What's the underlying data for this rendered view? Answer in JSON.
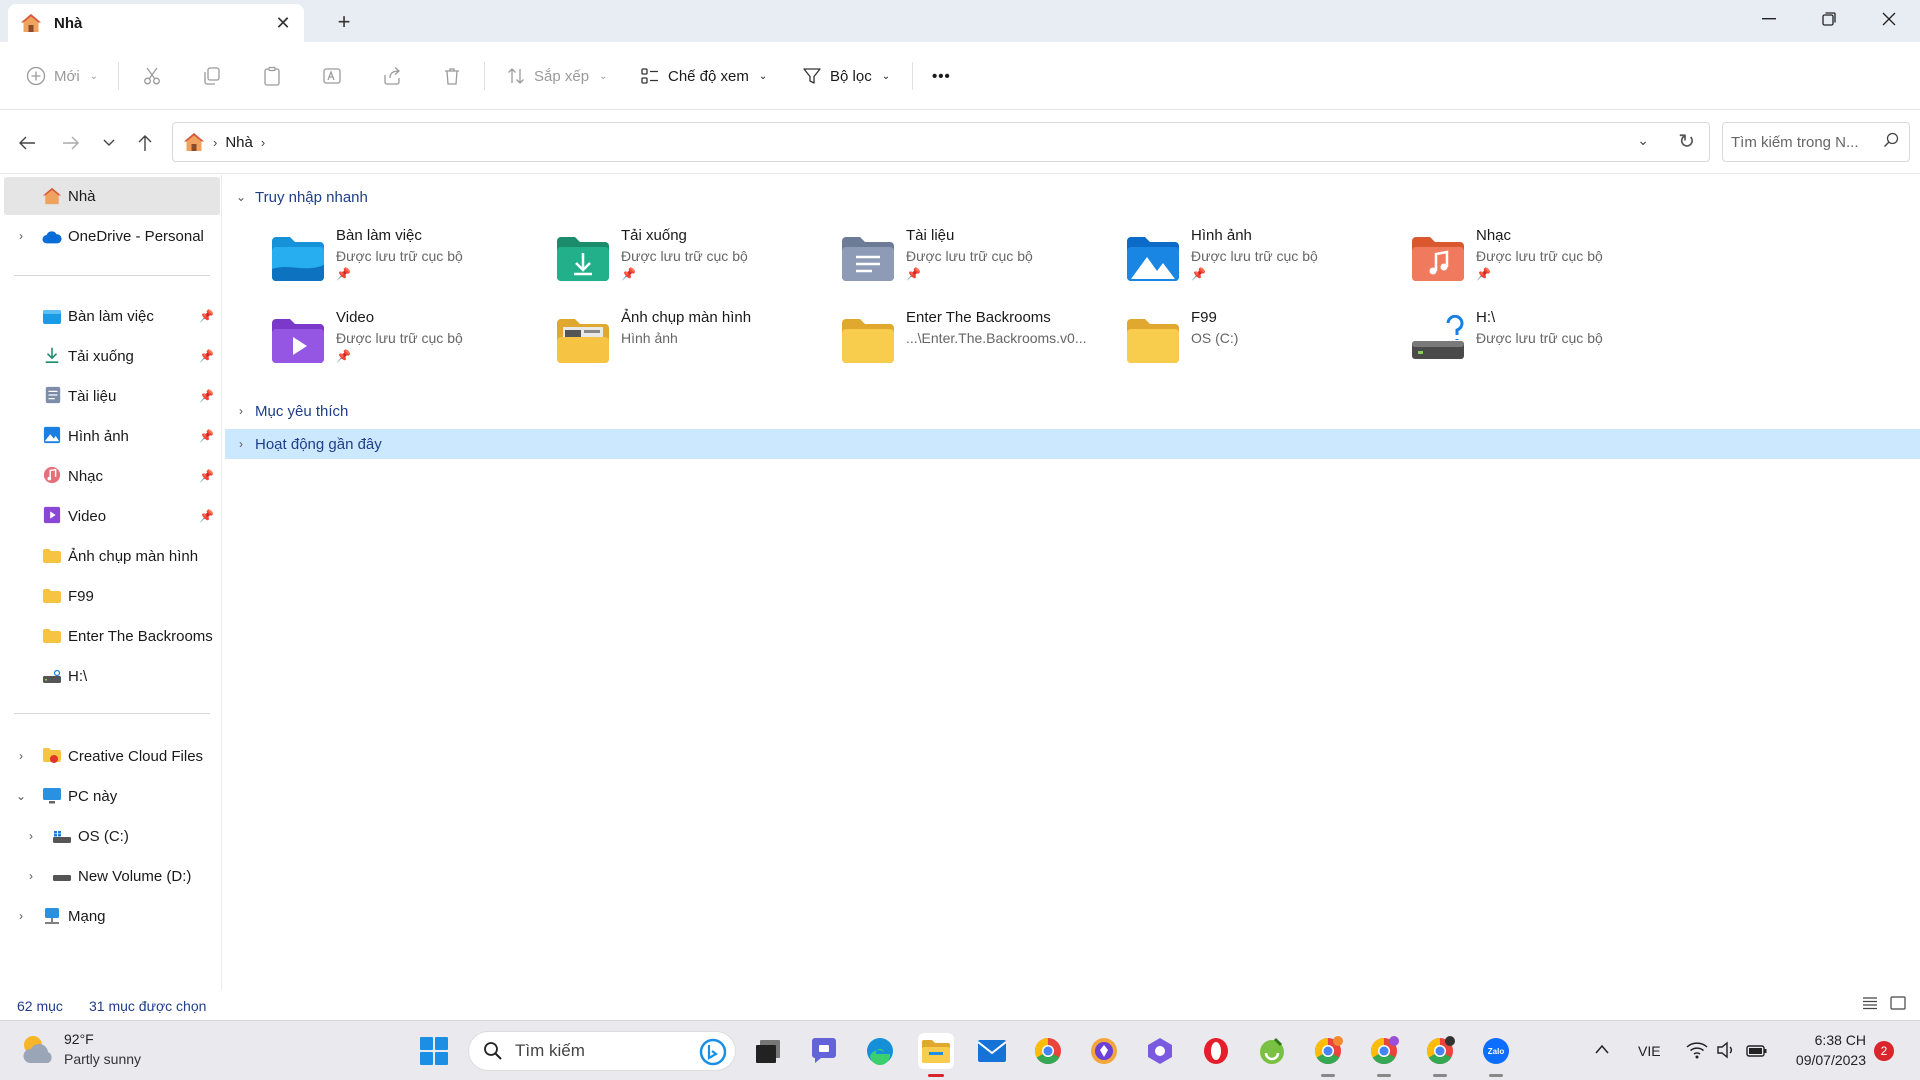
{
  "window": {
    "tab_title": "Nhà"
  },
  "toolbar": {
    "new": "Mới",
    "sort": "Sắp xếp",
    "view": "Chế độ xem",
    "filter": "Bộ lọc",
    "more": "•••"
  },
  "address": {
    "location": "Nhà",
    "search_placeholder": "Tìm kiếm trong N..."
  },
  "sidebar": {
    "home": "Nhà",
    "onedrive": "OneDrive - Personal",
    "pinned": [
      {
        "label": "Bàn làm việc"
      },
      {
        "label": "Tải xuống"
      },
      {
        "label": "Tài liệu"
      },
      {
        "label": "Hình ảnh"
      },
      {
        "label": "Nhạc"
      },
      {
        "label": "Video"
      }
    ],
    "folders": [
      {
        "label": "Ảnh chụp màn hình"
      },
      {
        "label": "F99"
      },
      {
        "label": "Enter The Backrooms"
      },
      {
        "label": "H:\\"
      }
    ],
    "creative_cloud": "Creative Cloud Files",
    "this_pc": "PC này",
    "drive_c": "OS (C:)",
    "drive_d": "New Volume (D:)",
    "network": "Mạng"
  },
  "main": {
    "quick_access_header": "Truy nhập nhanh",
    "favorites_header": "Mục yêu thích",
    "recent_header": "Hoạt động gần đây",
    "quick_access": [
      {
        "name": "Bàn làm việc",
        "sub": "Được lưu trữ cục bộ"
      },
      {
        "name": "Tải xuống",
        "sub": "Được lưu trữ cục bộ"
      },
      {
        "name": "Tài liệu",
        "sub": "Được lưu trữ cục bộ"
      },
      {
        "name": "Hình ảnh",
        "sub": "Được lưu trữ cục bộ"
      },
      {
        "name": "Nhạc",
        "sub": "Được lưu trữ cục bộ"
      },
      {
        "name": "Video",
        "sub": "Được lưu trữ cục bộ"
      },
      {
        "name": "Ảnh chụp màn hình",
        "sub": "Hình ảnh"
      },
      {
        "name": "Enter The Backrooms",
        "sub": "...\\Enter.The.Backrooms.v0..."
      },
      {
        "name": "F99",
        "sub": "OS (C:)"
      },
      {
        "name": "H:\\",
        "sub": "Được lưu trữ cục bộ"
      }
    ]
  },
  "status": {
    "items": "62 mục",
    "selected": "31 mục được chọn"
  },
  "taskbar": {
    "temp": "92°F",
    "condition": "Partly sunny",
    "search": "Tìm kiếm",
    "lang": "VIE",
    "time": "6:38 CH",
    "date": "09/07/2023",
    "notif_count": "2"
  },
  "colors": {
    "accent": "#0067c0",
    "selection": "#cce8ff",
    "link_text": "#1f3e8a"
  }
}
